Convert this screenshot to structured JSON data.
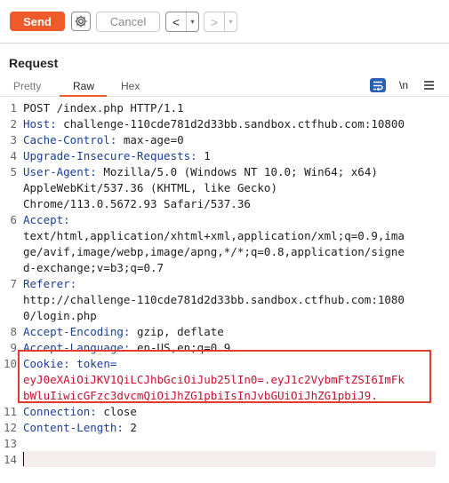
{
  "toolbar": {
    "send_label": "Send",
    "cancel_label": "Cancel",
    "back_glyph": "<",
    "forward_glyph": ">",
    "dropdown_glyph": "▾"
  },
  "panel": {
    "title": "Request",
    "tabs": [
      {
        "label": "Pretty",
        "active": false
      },
      {
        "label": "Raw",
        "active": true
      },
      {
        "label": "Hex",
        "active": false
      }
    ],
    "actions": {
      "newline_label": "\\n",
      "menu_glyph": "≡"
    }
  },
  "icons": {
    "settings": "gear-icon",
    "wrap_toggle": "wrap-lines-icon",
    "newline_toggle": "newline-icon",
    "menu": "hamburger-icon"
  },
  "colors": {
    "accent": "#ef5a2a",
    "header_key": "#1a3f99",
    "highlight": "#c8102e",
    "annotation_box": "#e53a2e"
  },
  "request_lines": [
    {
      "n": "1",
      "text": "POST /index.php HTTP/1.1"
    },
    {
      "n": "2",
      "key": "Host",
      "val": " challenge-110cde781d2d33bb.sandbox.ctfhub.com:10800"
    },
    {
      "n": "3",
      "key": "Cache-Control",
      "val": " max-age=0"
    },
    {
      "n": "4",
      "key": "Upgrade-Insecure-Requests",
      "val": " 1"
    },
    {
      "n": "5",
      "key": "User-Agent",
      "val": " Mozilla/5.0 (Windows NT 10.0; Win64; x64)",
      "wrap": [
        "AppleWebKit/537.36 (KHTML, like Gecko)",
        "Chrome/113.0.5672.93 Safari/537.36"
      ]
    },
    {
      "n": "6",
      "key": "Accept",
      "val": "",
      "wrap": [
        "text/html,application/xhtml+xml,application/xml;q=0.9,ima",
        "ge/avif,image/webp,image/apng,*/*;q=0.8,application/signe",
        "d-exchange;v=b3;q=0.7"
      ]
    },
    {
      "n": "7",
      "key": "Referer",
      "val": "",
      "wrap": [
        "http://challenge-110cde781d2d33bb.sandbox.ctfhub.com:1080",
        "0/login.php"
      ]
    },
    {
      "n": "8",
      "key": "Accept-Encoding",
      "val": " gzip, deflate"
    },
    {
      "n": "9",
      "key": "Accept-Language",
      "val": " en-US,en;q=0.9"
    },
    {
      "n": "10",
      "key": "Cookie",
      "val": " token=",
      "wrap": [
        "eyJ0eXAiOiJKV1QiLCJhbGciOiJub25lIn0=.eyJ1c2VybmFtZSI6ImFk",
        "bWluIiwicGFzc3dvcmQiOiJhZG1pbiIsInJvbGUiOiJhZG1pbiJ9."
      ]
    },
    {
      "n": "11",
      "key": "Connection",
      "val": " close"
    },
    {
      "n": "12",
      "key": "Content-Length",
      "val": " 2"
    },
    {
      "n": "13",
      "text": ""
    },
    {
      "n": "14",
      "text": ""
    }
  ]
}
